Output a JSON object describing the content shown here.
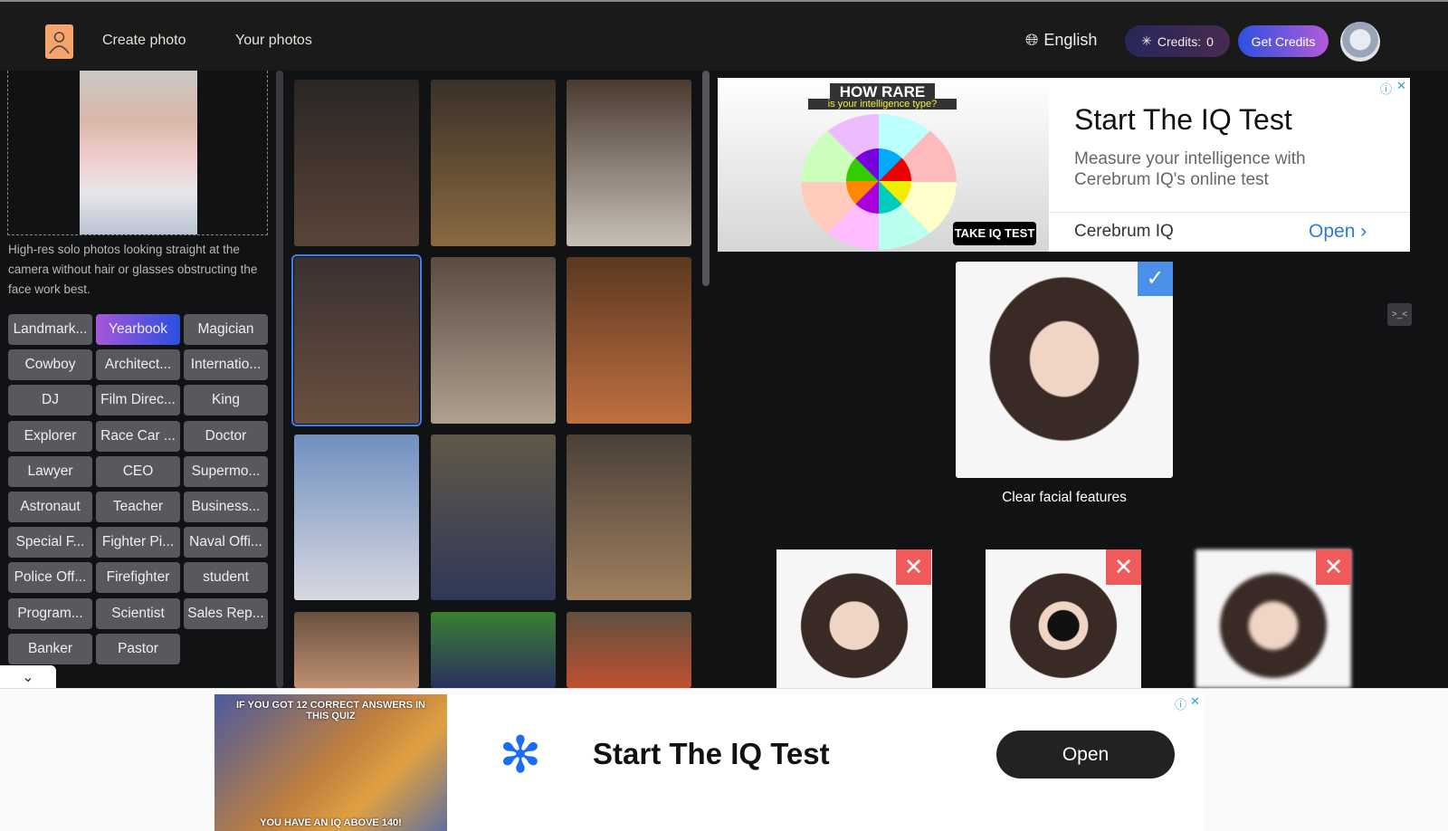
{
  "header": {
    "nav": [
      "Create photo",
      "Your photos"
    ],
    "language": "English",
    "credits_label": "Credits:",
    "credits_value": "0",
    "get_credits": "Get Credits"
  },
  "left": {
    "description": "High-res solo photos looking straight at the camera without hair or glasses obstructing the face work best.",
    "tags": [
      "Landmark...",
      "Yearbook",
      "Magician",
      "Cowboy",
      "Architect...",
      "Internatio...",
      "DJ",
      "Film Direc...",
      "King",
      "Explorer",
      "Race Car ...",
      "Doctor",
      "Lawyer",
      "CEO",
      "Supermo...",
      "Astronaut",
      "Teacher",
      "Business...",
      "Special F...",
      "Fighter Pi...",
      "Naval Offi...",
      "Police Off...",
      "Firefighter",
      "student",
      "Program...",
      "Scientist",
      "Sales Rep...",
      "Banker",
      "Pastor"
    ],
    "selected_tag": "Yearbook",
    "collapse_icon": "chevron-down"
  },
  "ad_top": {
    "image_title": "HOW RARE",
    "image_sub": "is your intelligence type?",
    "image_cta": "TAKE IQ TEST",
    "title": "Start The IQ Test",
    "subtitle": "Measure your intelligence with Cerebrum IQ's online test",
    "brand": "Cerebrum IQ",
    "open": "Open"
  },
  "guide": {
    "good_caption": "Clear facial features"
  },
  "ad_bottom": {
    "image_top": "IF YOU GOT 12 CORRECT ANSWERS IN THIS QUIZ",
    "image_bottom": "YOU HAVE AN IQ ABOVE 140!",
    "title": "Start The IQ Test",
    "open": "Open"
  },
  "colors": {
    "accent": "#3a7ff0",
    "good": "#4a90e8",
    "bad": "#f05a5a",
    "logo": "#f6a46a"
  }
}
